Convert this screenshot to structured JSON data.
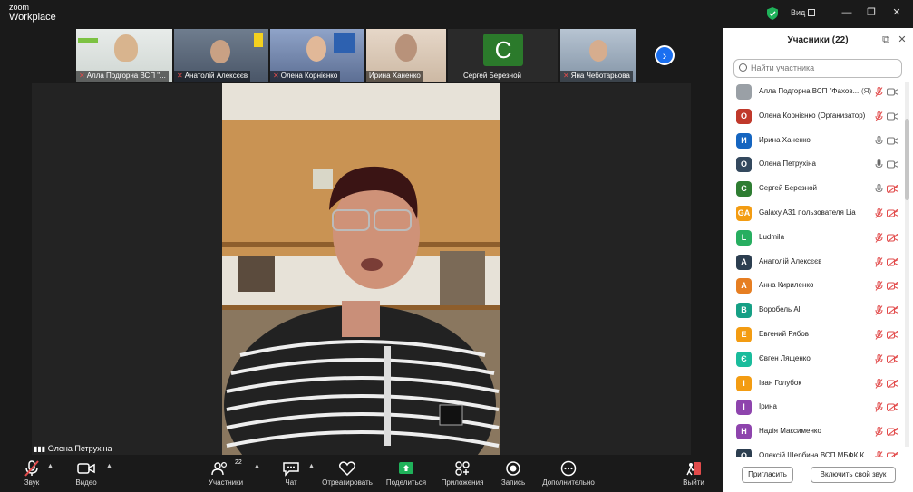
{
  "app": {
    "logo_line1": "zoom",
    "logo_line2": "Workplace",
    "view_label": "Вид"
  },
  "thumbnails": [
    {
      "name": "Алла Подгорна ВСП \"...",
      "muted": true
    },
    {
      "name": "Анатолій Алексєєв",
      "muted": true
    },
    {
      "name": "Олена Корнієнко",
      "muted": true
    },
    {
      "name": "Ирина Ханенко",
      "muted": false
    },
    {
      "name": "Сергей Березной",
      "muted": false,
      "avatar_letter": "C"
    },
    {
      "name": "Яна Чеботарьова",
      "muted": true
    }
  ],
  "main_video": {
    "speaker_name": "Олена Петрухіна"
  },
  "participants_panel": {
    "title": "Учасники (22)",
    "search_placeholder": "Найти участника",
    "participants": [
      {
        "initial": "",
        "name": "Алла Подгорна ВСП \"Фахов...",
        "tag": "(Я)",
        "color": "#9aa0a6",
        "mic": "muted",
        "cam": "on"
      },
      {
        "initial": "О",
        "name": "Олена Корнієнко (Организатор)",
        "tag": "",
        "color": "#c0392b",
        "mic": "muted",
        "cam": "on"
      },
      {
        "initial": "И",
        "name": "Ирина Ханенко",
        "tag": "",
        "color": "#1565c0",
        "mic": "on",
        "cam": "on"
      },
      {
        "initial": "О",
        "name": "Олена Петрухіна",
        "tag": "",
        "color": "#34495e",
        "mic": "active",
        "cam": "on"
      },
      {
        "initial": "С",
        "name": "Сергей Березной",
        "tag": "",
        "color": "#2e7d32",
        "mic": "on",
        "cam": "off"
      },
      {
        "initial": "GA",
        "name": "Galaxy A31 пользователя Lia",
        "tag": "",
        "color": "#f39c12",
        "mic": "muted",
        "cam": "off"
      },
      {
        "initial": "L",
        "name": "Ludmila",
        "tag": "",
        "color": "#27ae60",
        "mic": "muted",
        "cam": "off"
      },
      {
        "initial": "А",
        "name": "Анатолій Алексєєв",
        "tag": "",
        "color": "#2c3e50",
        "mic": "muted",
        "cam": "off"
      },
      {
        "initial": "А",
        "name": "Анна Кириленко",
        "tag": "",
        "color": "#e67e22",
        "mic": "muted",
        "cam": "off"
      },
      {
        "initial": "В",
        "name": "Воробель Al",
        "tag": "",
        "color": "#16a085",
        "mic": "muted",
        "cam": "off"
      },
      {
        "initial": "Е",
        "name": "Евгений Рябов",
        "tag": "",
        "color": "#f39c12",
        "mic": "muted",
        "cam": "off"
      },
      {
        "initial": "Є",
        "name": "Євген Лященко",
        "tag": "",
        "color": "#1abc9c",
        "mic": "muted",
        "cam": "off"
      },
      {
        "initial": "І",
        "name": "Іван Голубок",
        "tag": "",
        "color": "#f39c12",
        "mic": "muted",
        "cam": "off"
      },
      {
        "initial": "І",
        "name": "Ірина",
        "tag": "",
        "color": "#8e44ad",
        "mic": "muted",
        "cam": "off"
      },
      {
        "initial": "Н",
        "name": "Надія Максименко",
        "tag": "",
        "color": "#8e44ad",
        "mic": "muted",
        "cam": "off"
      },
      {
        "initial": "О",
        "name": "Олексій Щербина ВСП МБФК К...",
        "tag": "",
        "color": "#2c3e50",
        "mic": "muted",
        "cam": "off"
      }
    ],
    "invite_label": "Пригласить",
    "unmute_label": "Включить свой звук"
  },
  "toolbar": {
    "audio": "Звук",
    "video": "Видео",
    "participants": "Участники",
    "participants_count": "22",
    "chat": "Чат",
    "react": "Отреагировать",
    "share": "Поделиться",
    "apps": "Приложения",
    "record": "Запись",
    "more": "Дополнительно",
    "leave": "Выйти"
  },
  "colors": {
    "accent": "#1a6ff0",
    "share_green": "#1fb25a",
    "muted_red": "#e24b4b",
    "leave_red": "#e24b4b",
    "shield_green": "#1fb25a"
  }
}
